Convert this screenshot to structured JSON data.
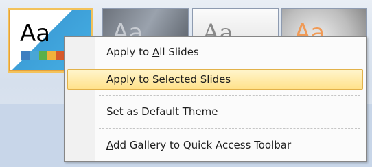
{
  "gallery": {
    "themes": [
      {
        "label": "Aa",
        "selected": true
      },
      {
        "label": "Aa",
        "selected": false
      },
      {
        "label": "Aa",
        "selected": false
      },
      {
        "label": "Aa",
        "selected": false
      }
    ],
    "theme1_stripe_colors": [
      "#3f7fc0",
      "#48a6d6",
      "#5bb04a",
      "#f0b13b",
      "#d75a2b"
    ]
  },
  "context_menu": {
    "items": [
      {
        "pre": "Apply to ",
        "key": "A",
        "post": "ll Slides",
        "highlighted": false
      },
      {
        "pre": "Apply to ",
        "key": "S",
        "post": "elected Slides",
        "highlighted": true
      },
      {
        "pre": "",
        "key": "S",
        "post": "et as Default Theme",
        "highlighted": false
      },
      {
        "pre": "",
        "key": "A",
        "post": "dd Gallery to Quick Access Toolbar",
        "highlighted": false
      }
    ]
  },
  "colors": {
    "highlight_border": "#e2b24a",
    "highlight_fill": "#ffe18a",
    "selection_frame": "#f2c25b"
  }
}
